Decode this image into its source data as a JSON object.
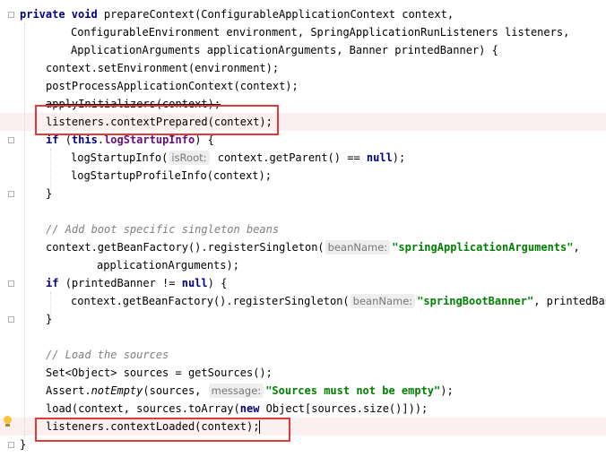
{
  "editor": {
    "lines": [
      {
        "tokens": [
          {
            "k": "kw",
            "t": "private "
          },
          {
            "k": "kw",
            "t": "void "
          },
          {
            "t": "prepareContext(ConfigurableApplicationContext context,"
          }
        ]
      },
      {
        "tokens": [
          {
            "t": "Configurable"
          },
          {
            "t": "Environment environment, SpringApplicationRunListeners listeners,"
          }
        ]
      },
      {
        "tokens": [
          {
            "t": "ApplicationArguments applicationArguments, Banner printedBanner) {"
          }
        ]
      },
      {
        "tokens": [
          {
            "t": "context.setEnvironment(environment);"
          }
        ]
      },
      {
        "tokens": [
          {
            "t": "postProcessApplicationContext(context);"
          }
        ]
      },
      {
        "tokens": [
          {
            "k": "strike",
            "t": "applyInitializers(context);"
          }
        ]
      },
      {
        "tokens": [
          {
            "t": "listeners.contextPrepared(context);"
          }
        ]
      },
      {
        "tokens": [
          {
            "k": "kw",
            "t": "if "
          },
          {
            "t": "("
          },
          {
            "k": "kw",
            "t": "this"
          },
          {
            "t": "."
          },
          {
            "k": "fld",
            "t": "logStartupInfo"
          },
          {
            "t": ") {"
          }
        ]
      },
      {
        "tokens": [
          {
            "t": "logStartupInfo("
          },
          {
            "k": "hint",
            "t": "isRoot:"
          },
          {
            "t": " context.getParent() == "
          },
          {
            "k": "kw",
            "t": "null"
          },
          {
            "t": ");"
          }
        ]
      },
      {
        "tokens": [
          {
            "t": "logStartupProfileInfo(context);"
          }
        ]
      },
      {
        "tokens": [
          {
            "t": "}"
          }
        ]
      },
      {
        "tokens": []
      },
      {
        "tokens": [
          {
            "k": "cmt",
            "t": "// Add boot specific singleton beans"
          }
        ]
      },
      {
        "tokens": [
          {
            "t": "context.getBeanFactory().registerSingleton("
          },
          {
            "k": "hint",
            "t": "beanName:"
          },
          {
            "k": "str",
            "t": "\"springApplicationArguments\""
          },
          {
            "t": ","
          }
        ]
      },
      {
        "tokens": [
          {
            "t": "applicationArguments);"
          }
        ]
      },
      {
        "tokens": [
          {
            "k": "kw",
            "t": "if "
          },
          {
            "t": "(printedBanner != "
          },
          {
            "k": "kw",
            "t": "null"
          },
          {
            "t": ") {"
          }
        ]
      },
      {
        "tokens": [
          {
            "t": "context.getBeanFactory().registerSingleton("
          },
          {
            "k": "hint",
            "t": "beanName:"
          },
          {
            "k": "str",
            "t": "\"springBootBanner\""
          },
          {
            "t": ", printedBanner);"
          }
        ]
      },
      {
        "tokens": [
          {
            "t": "}"
          }
        ]
      },
      {
        "tokens": []
      },
      {
        "tokens": [
          {
            "k": "cmt",
            "t": "// Load the sources"
          }
        ]
      },
      {
        "tokens": [
          {
            "t": "Set<Object> sources = getSources();"
          }
        ]
      },
      {
        "tokens": [
          {
            "t": "Assert."
          },
          {
            "k": "it",
            "t": "notEmpty"
          },
          {
            "t": "(sources, "
          },
          {
            "k": "hint",
            "t": "message:"
          },
          {
            "k": "str",
            "t": "\"Sources must not be empty\""
          },
          {
            "t": ");"
          }
        ]
      },
      {
        "tokens": [
          {
            "t": "load(context, sources.toArray("
          },
          {
            "k": "kw",
            "t": "new "
          },
          {
            "t": "Object[sources.size()]));"
          }
        ]
      },
      {
        "tokens": [
          {
            "t": "listeners.contextLoaded(context);"
          }
        ]
      },
      {
        "tokens": [
          {
            "t": "}"
          }
        ]
      }
    ]
  },
  "colors": {
    "keyword": "#000080",
    "field": "#660e7a",
    "string": "#008000",
    "comment": "#808080",
    "highlight_line": "#fcefef",
    "annotation_box": "#e03a3a"
  },
  "icons": {
    "gutter": "intention-bulb-icon"
  }
}
